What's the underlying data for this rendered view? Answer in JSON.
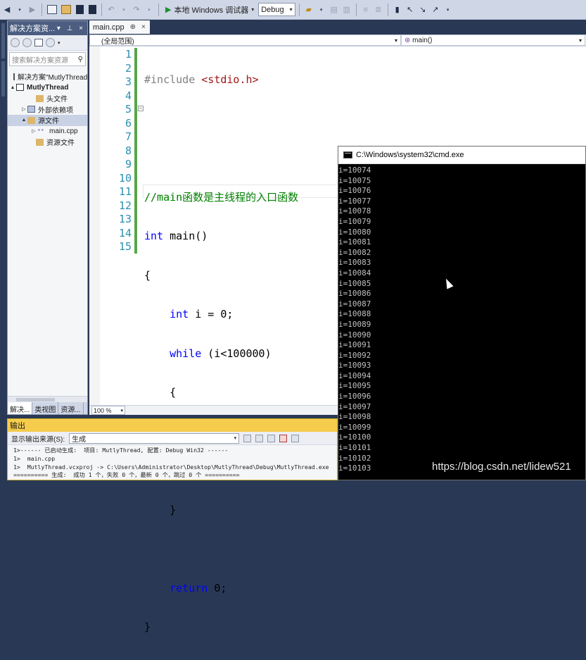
{
  "toolbar": {
    "run_label": "本地 Windows 调试器",
    "config_value": "Debug"
  },
  "solution_explorer": {
    "title": "解决方案资...",
    "title_controls": "▾ ⊥ ×",
    "search_placeholder": "搜索解决方案资源",
    "tree": [
      {
        "label": "解决方案\"MutlyThread\"",
        "icon": "solution-icon",
        "expand": "",
        "indent": 8,
        "bold": false,
        "selected": false
      },
      {
        "label": "MutlyThread",
        "icon": "project-icon",
        "expand": "▲",
        "indent": 2,
        "bold": true,
        "selected": false
      },
      {
        "label": "头文件",
        "icon": "folder-icon",
        "expand": "",
        "indent": 30,
        "bold": false,
        "selected": false
      },
      {
        "label": "外部依赖项",
        "icon": "external-deps-icon",
        "expand": "▷",
        "indent": 18,
        "bold": false,
        "selected": false
      },
      {
        "label": "源文件",
        "icon": "folder-icon",
        "expand": "▲",
        "indent": 18,
        "bold": false,
        "selected": true
      },
      {
        "label": "main.cpp",
        "icon": "cpp-file-icon",
        "expand": "▷",
        "indent": 32,
        "bold": false,
        "selected": false
      },
      {
        "label": "资源文件",
        "icon": "folder-icon",
        "expand": "",
        "indent": 30,
        "bold": false,
        "selected": false
      }
    ],
    "bottom_tabs": [
      "解决...",
      "类视图",
      "资源..."
    ]
  },
  "editor": {
    "tab_label": "main.cpp",
    "tab_pin": "⊕",
    "tab_close": "×",
    "scope_left": "(全局范围)",
    "scope_right": "main()",
    "zoom": "100 %",
    "line_numbers": [
      "1",
      "2",
      "3",
      "4",
      "5",
      "6",
      "7",
      "8",
      "9",
      "10",
      "11",
      "12",
      "13",
      "14",
      "15"
    ]
  },
  "cmd": {
    "title": "C:\\Windows\\system32\\cmd.exe",
    "lines": [
      "i=10074",
      "i=10075",
      "i=10076",
      "i=10077",
      "i=10078",
      "i=10079",
      "i=10080",
      "i=10081",
      "i=10082",
      "i=10083",
      "i=10084",
      "i=10085",
      "i=10086",
      "i=10087",
      "i=10088",
      "i=10089",
      "i=10090",
      "i=10091",
      "i=10092",
      "i=10093",
      "i=10094",
      "i=10095",
      "i=10096",
      "i=10097",
      "i=10098",
      "i=10099",
      "i=10100",
      "i=10101",
      "i=10102",
      "i=10103"
    ]
  },
  "output": {
    "title": "输出",
    "source_label": "显示输出来源(S):",
    "source_value": "生成",
    "lines": [
      "1>------ 已启动生成:  项目: MutlyThread, 配置: Debug Win32 ------",
      "1>  main.cpp",
      "1>  MutlyThread.vcxproj -> C:\\Users\\Administrator\\Desktop\\MutlyThread\\Debug\\MutlyThread.exe",
      "========== 生成:  成功 1 个，失败 0 个，最新 0 个，跳过 0 个 =========="
    ]
  },
  "watermark": "https://blog.csdn.net/lidew521",
  "colors": {
    "keyword": "#0000ff",
    "string": "#a31515",
    "comment": "#008000",
    "preprocessor": "#808080",
    "line_number": "#2b91af",
    "output_title_bg": "#f5cc4c"
  }
}
